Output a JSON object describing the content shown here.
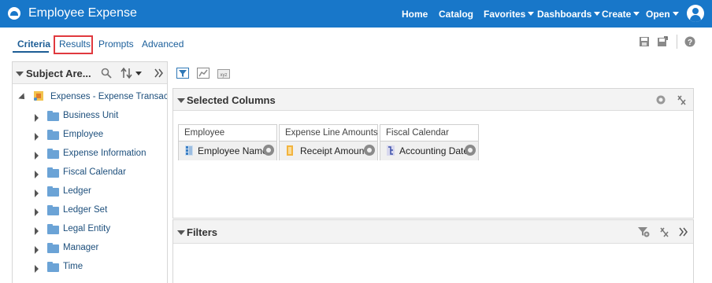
{
  "app": {
    "title": "Employee Expense"
  },
  "nav": {
    "home": "Home",
    "catalog": "Catalog",
    "favorites": "Favorites",
    "dashboards": "Dashboards",
    "create": "Create",
    "open": "Open"
  },
  "tabs": {
    "criteria": "Criteria",
    "results": "Results",
    "prompts": "Prompts",
    "advanced": "Advanced"
  },
  "subject_area": {
    "title": "Subject Are...",
    "root": "Expenses - Expense Transactions",
    "items": [
      "Business Unit",
      "Employee",
      "Expense Information",
      "Fiscal Calendar",
      "Ledger",
      "Ledger Set",
      "Legal Entity",
      "Manager",
      "Time"
    ]
  },
  "selected_columns": {
    "title": "Selected Columns",
    "groups": [
      {
        "header": "Employee",
        "column": "Employee Name"
      },
      {
        "header": "Expense Line Amounts",
        "column": "Receipt Amount"
      },
      {
        "header": "Fiscal Calendar",
        "column": "Accounting Date"
      }
    ]
  },
  "filters": {
    "title": "Filters"
  },
  "icons": [
    "app-logo-icon",
    "user-avatar-icon",
    "save-icon",
    "save-as-icon",
    "help-icon",
    "search-icon",
    "sort-icon",
    "collapse-panel-icon",
    "filter-toolbar-icon",
    "chart-toolbar-icon",
    "xyz-toolbar-icon",
    "show-hide-icon",
    "clear-icon",
    "add-filter-icon",
    "expand-icon",
    "gear-icon"
  ],
  "colors": {
    "header_bg": "#1877c9",
    "link": "#1d4f7c",
    "highlight": "#e0393e"
  }
}
